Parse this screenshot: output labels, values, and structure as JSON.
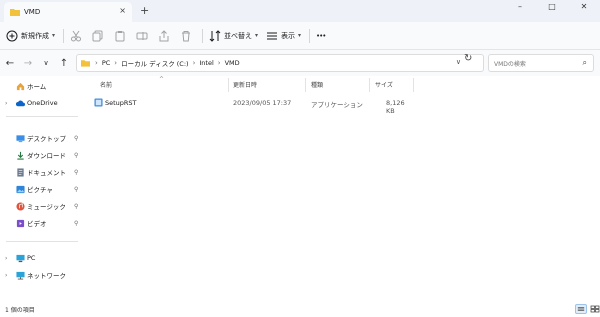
{
  "window": {
    "tab_title": "VMD",
    "new_tab": "+",
    "tab_close": "×",
    "minimize": "–",
    "maximize": "□",
    "close": "✕"
  },
  "toolbar": {
    "new_label": "新規作成",
    "sort_label": "並べ替え",
    "view_label": "表示",
    "more_label": "•••"
  },
  "address": {
    "crumbs": [
      "PC",
      "ローカル ディスク (C:)",
      "Intel",
      "VMD"
    ],
    "search_placeholder": "VMDの検索"
  },
  "sidebar": {
    "home": "ホーム",
    "onedrive": "OneDrive",
    "desktop": "デスクトップ",
    "downloads": "ダウンロード",
    "documents": "ドキュメント",
    "pictures": "ピクチャ",
    "music": "ミュージック",
    "videos": "ビデオ",
    "pc": "PC",
    "network": "ネットワーク"
  },
  "columns": {
    "name": "名前",
    "modified": "更新日時",
    "type": "種類",
    "size": "サイズ"
  },
  "files": [
    {
      "name": "SetupRST",
      "modified": "2023/09/05 17:37",
      "type": "アプリケーション",
      "size": "8,126 KB"
    }
  ],
  "status": {
    "count": "1 個の項目"
  },
  "colors": {
    "accent": "#0067c0",
    "folder": "#f3c23d"
  }
}
